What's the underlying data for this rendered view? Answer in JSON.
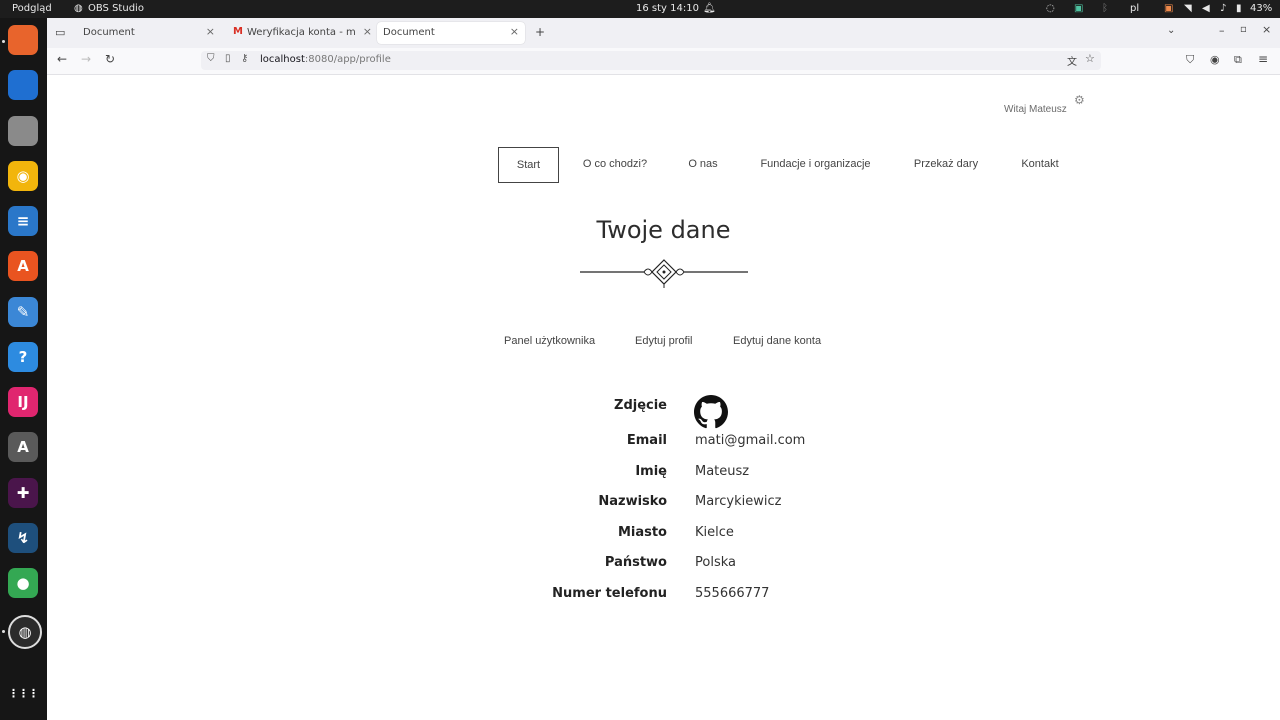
{
  "os_bar": {
    "preview_label": "Podgląd",
    "app_label": "OBS Studio",
    "clock": "16 sty  14:10",
    "language": "pl",
    "battery": "43%"
  },
  "browser": {
    "tabs": [
      {
        "label": "Document",
        "active": false
      },
      {
        "label": "Weryfikacja konta - mma",
        "active": false
      },
      {
        "label": "Document",
        "active": true
      }
    ],
    "new_tab_symbol": "+",
    "url": {
      "host": "localhost",
      "rest": ":8080/app/profile"
    }
  },
  "page": {
    "welcome": "Witaj Mateusz",
    "nav": [
      {
        "label": "Start",
        "active": true
      },
      {
        "label": "O co chodzi?",
        "active": false
      },
      {
        "label": "O nas",
        "active": false
      },
      {
        "label": "Fundacje i organizacje",
        "active": false
      },
      {
        "label": "Przekaż dary",
        "active": false
      },
      {
        "label": "Kontakt",
        "active": false
      }
    ],
    "title": "Twoje dane",
    "sub_links": [
      "Panel użytkownika",
      "Edytuj profil",
      "Edytuj dane konta"
    ],
    "photo_label": "Zdjęcie",
    "avatar_icon": "github-icon",
    "fields": [
      {
        "label": "Email",
        "value": "mati@gmail.com"
      },
      {
        "label": "Imię",
        "value": "Mateusz"
      },
      {
        "label": "Nazwisko",
        "value": "Marcykiewicz"
      },
      {
        "label": "Miasto",
        "value": "Kielce"
      },
      {
        "label": "Państwo",
        "value": "Polska"
      },
      {
        "label": "Numer telefonu",
        "value": "555666777"
      }
    ]
  },
  "dock": {
    "apps": [
      {
        "name": "firefox-icon",
        "color": "#e8642c",
        "glyph": ""
      },
      {
        "name": "thunderbird-icon",
        "color": "#1f6fd1",
        "glyph": ""
      },
      {
        "name": "files-icon",
        "color": "#8a8a8a",
        "glyph": ""
      },
      {
        "name": "rhythmbox-icon",
        "color": "#f2b50c",
        "glyph": "◉"
      },
      {
        "name": "writer-icon",
        "color": "#2a77c9",
        "glyph": "≡"
      },
      {
        "name": "app-center-icon",
        "color": "#e95420",
        "glyph": "A"
      },
      {
        "name": "text-editor-icon",
        "color": "#3b87d6",
        "glyph": "✎"
      },
      {
        "name": "help-icon",
        "color": "#2d8be0",
        "glyph": "?"
      },
      {
        "name": "intellij-icon",
        "color": "#e0266f",
        "glyph": "IJ"
      },
      {
        "name": "software-updater-icon",
        "color": "#5a5a5a",
        "glyph": "A"
      },
      {
        "name": "slack-icon",
        "color": "#4a154b",
        "glyph": "✚"
      },
      {
        "name": "mysql-workbench-icon",
        "color": "#1e4f7c",
        "glyph": "↯"
      },
      {
        "name": "chrome-icon",
        "color": "#34a853",
        "glyph": "●"
      },
      {
        "name": "obs-icon",
        "color": "#2b2b2b",
        "glyph": "◍"
      },
      {
        "name": "drive-icon",
        "color": "#3a3a3a",
        "glyph": ""
      },
      {
        "name": "app-grid-icon",
        "color": "#161616",
        "glyph": "⋮⋮⋮"
      }
    ]
  }
}
